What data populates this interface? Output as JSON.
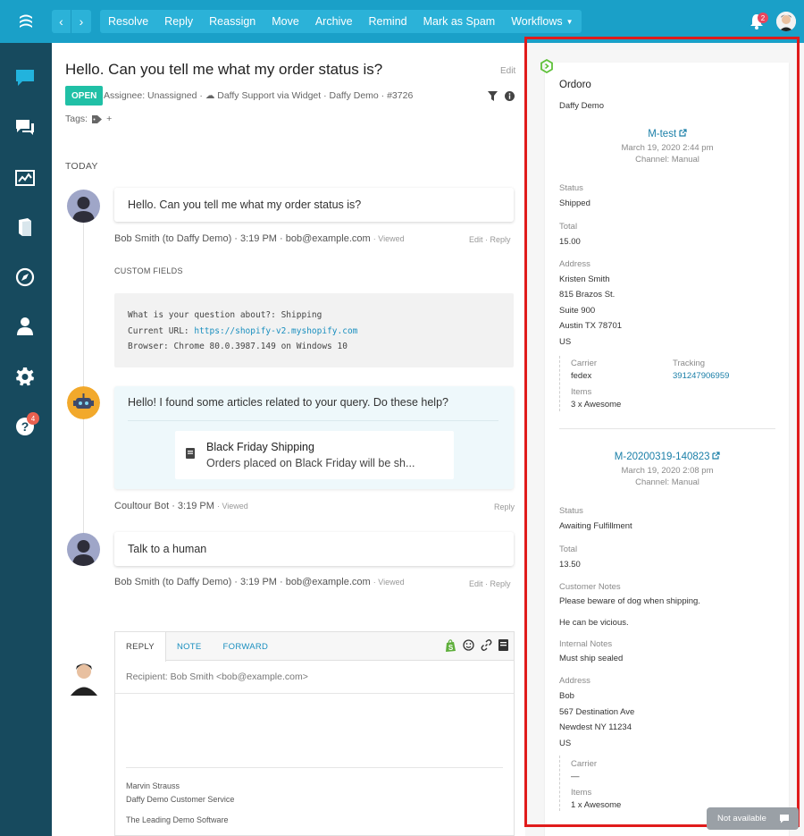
{
  "toolbar": {
    "actions": [
      "Resolve",
      "Reply",
      "Reassign",
      "Move",
      "Archive",
      "Remind",
      "Mark as Spam",
      "Workflows"
    ],
    "notification_count": "2"
  },
  "sidebar": {
    "help_badge": "4",
    "items": [
      "chat-icon",
      "conversations-icon",
      "reports-icon",
      "knowledge-base-icon",
      "compass-icon",
      "contacts-icon",
      "settings-icon",
      "help-icon"
    ]
  },
  "conversation": {
    "subject": "Hello. Can you tell me what my order status is?",
    "edit_label": "Edit",
    "status": "OPEN",
    "meta": "Assignee: Unassigned · ☁ Daffy Support via Widget · Daffy Demo · #3726",
    "tags_label": "Tags:",
    "tag_add": "+",
    "today_label": "TODAY",
    "messages": [
      {
        "text": "Hello. Can you tell me what my order status is?",
        "meta": "Bob Smith (to Daffy Demo) · 3:19 PM · bob@example.com",
        "viewed": "· Viewed",
        "edit": "Edit",
        "reply": "Reply"
      },
      {
        "text": "Hello! I found some articles related to your query. Do these help?",
        "article_title": "Black Friday Shipping",
        "article_sub": "Orders placed on Black Friday will be sh...",
        "meta": "Coultour Bot · 3:19 PM",
        "viewed": "· Viewed",
        "reply": "Reply"
      },
      {
        "text": "Talk to a human",
        "meta": "Bob Smith (to Daffy Demo) · 3:19 PM · bob@example.com",
        "viewed": "· Viewed",
        "edit": "Edit",
        "reply": "Reply"
      }
    ],
    "custom_fields_label": "CUSTOM FIELDS",
    "custom_fields": {
      "line1": "What is your question about?: Shipping",
      "line2_prefix": "Current URL: ",
      "line2_link": "https://shopify-v2.myshopify.com",
      "line3": "Browser: Chrome 80.0.3987.149 on Windows 10"
    },
    "separator": "·"
  },
  "reply": {
    "tabs": [
      "REPLY",
      "NOTE",
      "FORWARD"
    ],
    "recipient": "Recipient: Bob Smith <bob@example.com>",
    "signature": [
      "Marvin Strauss",
      "Daffy Demo Customer Service",
      "The Leading Demo Software"
    ]
  },
  "ordoro": {
    "title": "Ordoro",
    "account": "Daffy Demo",
    "orders": [
      {
        "id": "M-test",
        "date": "March 19, 2020 2:44 pm",
        "channel": "Channel: Manual",
        "status_label": "Status",
        "status": "Shipped",
        "total_label": "Total",
        "total": "15.00",
        "address_label": "Address",
        "address": [
          "Kristen Smith",
          "815 Brazos St.",
          "Suite 900",
          "Austin TX 78701",
          "US"
        ],
        "carrier_label": "Carrier",
        "carrier": "fedex",
        "tracking_label": "Tracking",
        "tracking": "391247906959",
        "items_label": "Items",
        "items": "3 x Awesome"
      },
      {
        "id": "M-20200319-140823",
        "date": "March 19, 2020 2:08 pm",
        "channel": "Channel: Manual",
        "status_label": "Status",
        "status": "Awaiting Fulfillment",
        "total_label": "Total",
        "total": "13.50",
        "customer_notes_label": "Customer Notes",
        "customer_notes": [
          "Please beware of dog when shipping.",
          "He can be vicious."
        ],
        "internal_notes_label": "Internal Notes",
        "internal_notes": "Must ship sealed",
        "address_label": "Address",
        "address": [
          "Bob",
          "567 Destination Ave",
          "Newdest NY 11234",
          "US"
        ],
        "carrier_label": "Carrier",
        "carrier": "—",
        "items_label": "Items",
        "items": "1 x Awesome"
      }
    ]
  },
  "chat_status": "Not available",
  "colors": {
    "topbar": "#1aa0c8",
    "sidebar": "#174a5e",
    "open": "#20c0a6",
    "link": "#1a7fa8",
    "highlight": "#e01b1b"
  }
}
